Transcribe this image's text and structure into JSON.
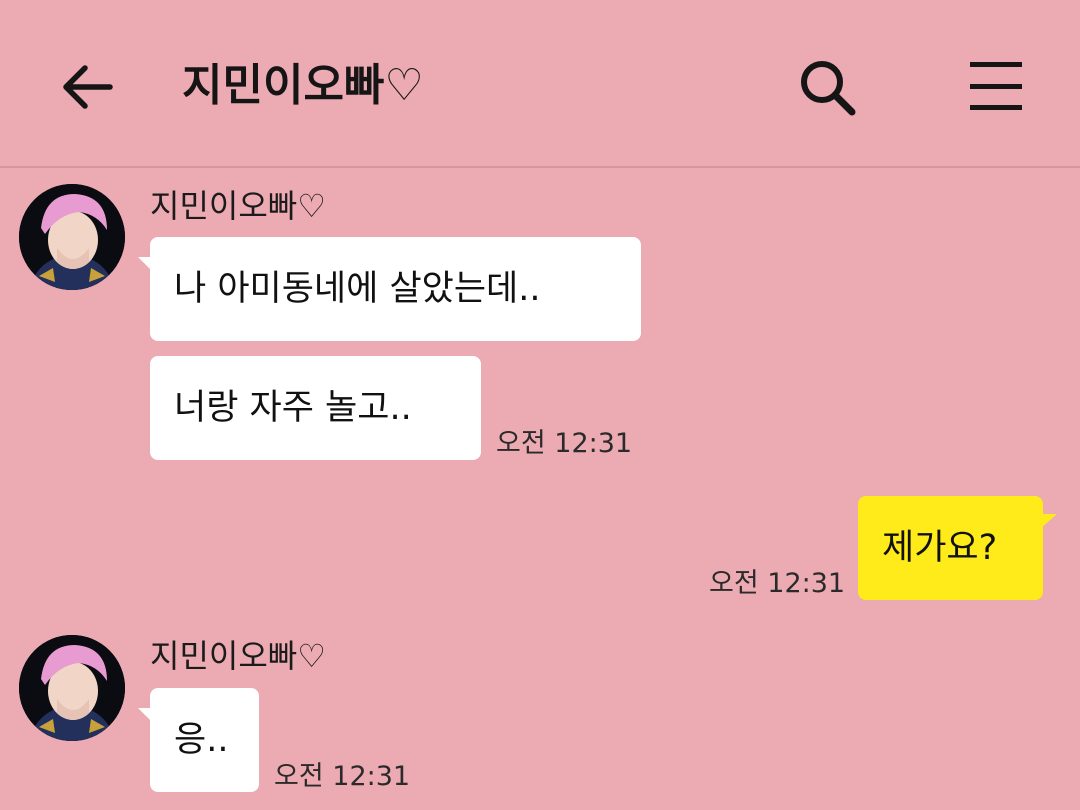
{
  "header": {
    "title": "지민이오빠♡",
    "back_icon": "arrow-left-icon",
    "search_icon": "search-icon",
    "menu_icon": "hamburger-menu-icon"
  },
  "colors": {
    "background": "#ecaab2",
    "incoming_bubble": "#ffffff",
    "outgoing_bubble": "#ffeb1a"
  },
  "messages": [
    {
      "sender": "지민이오빠♡",
      "bubbles": [
        "나 아미동네에 살았는데..",
        "너랑 자주 놀고.."
      ],
      "time": "오전 12:31"
    },
    {
      "sender": "me",
      "bubbles": [
        "제가요?"
      ],
      "time": "오전 12:31"
    },
    {
      "sender": "지민이오빠♡",
      "bubbles": [
        "응.."
      ],
      "time": "오전 12:31"
    }
  ]
}
